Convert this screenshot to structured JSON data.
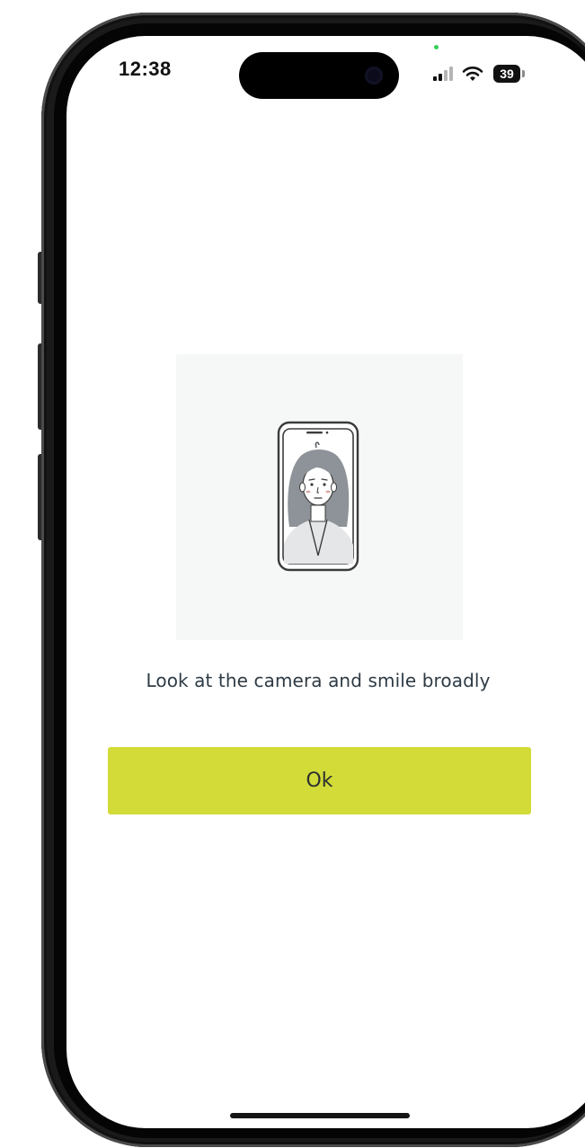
{
  "status_bar": {
    "time": "12:38",
    "battery_level": "39",
    "privacy_indicator_color": "#35d05a"
  },
  "illustration": {
    "icon": "selfie-phone-icon"
  },
  "instruction": {
    "text": "Look at the camera and smile broadly"
  },
  "actions": {
    "ok_label": "Ok",
    "ok_color": "#d2db38"
  }
}
